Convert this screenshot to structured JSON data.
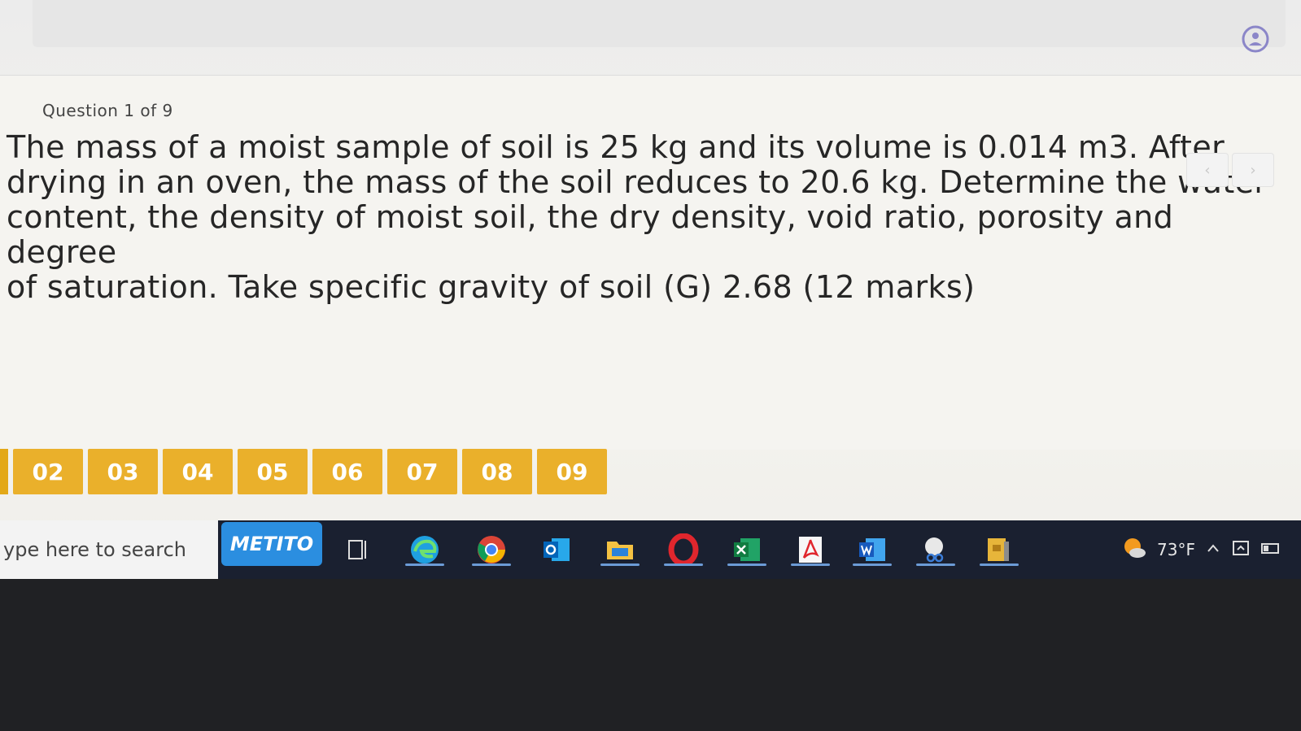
{
  "question": {
    "counter": "Question 1 of 9",
    "text": "The mass of a moist sample of soil is 25 kg and its volume is 0.014 m3. After\ndrying in an oven, the mass of the soil reduces to 20.6 kg. Determine the water\ncontent, the density of moist soil, the dry density, void ratio, porosity and degree\nof saturation. Take specific gravity of soil (G) 2.68 (12 marks)",
    "prev_label": "‹",
    "next_label": "›"
  },
  "question_nav": [
    "02",
    "03",
    "04",
    "05",
    "06",
    "07",
    "08",
    "09"
  ],
  "taskbar": {
    "search_placeholder": "ype here to search",
    "brand_label": "METITO",
    "apps": [
      "task-view",
      "edge",
      "chrome",
      "outlook",
      "file-explorer",
      "opera",
      "excel",
      "acrobat",
      "word",
      "snipping-tool",
      "archive"
    ],
    "temperature": "73°F"
  },
  "colors": {
    "accent": "#eab02b",
    "taskbar": "#1a2030",
    "brand": "#2b8ee0"
  }
}
